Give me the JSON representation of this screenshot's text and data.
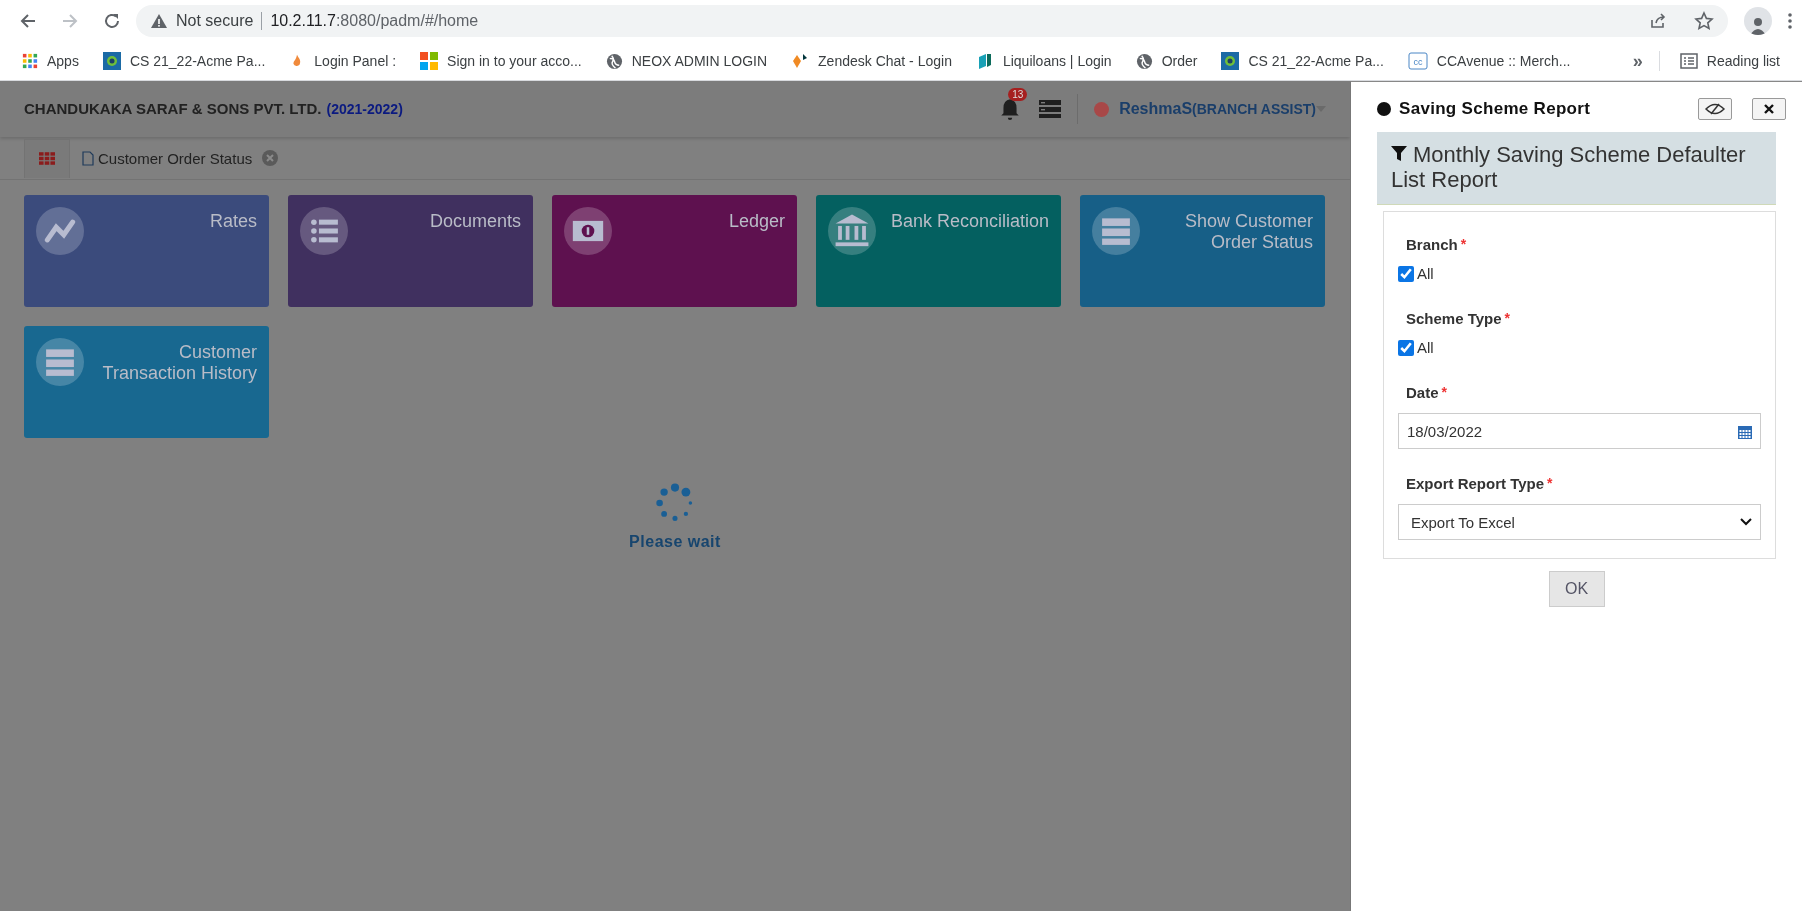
{
  "browser": {
    "security": "Not secure",
    "url_host": "10.2.11.7",
    "url_rest": ":8080/padm/#/home",
    "bookmarks": [
      {
        "kind": "apps",
        "label": "Apps"
      },
      {
        "kind": "tile",
        "label": "CS 21_22-Acme Pa..."
      },
      {
        "kind": "flame",
        "label": "Login Panel :"
      },
      {
        "kind": "windows",
        "label": "Sign in to your acco..."
      },
      {
        "kind": "globe",
        "label": "NEOX ADMIN LOGIN"
      },
      {
        "kind": "diamond",
        "label": "Zendesk Chat - Login"
      },
      {
        "kind": "book",
        "label": "Liquiloans | Login"
      },
      {
        "kind": "globe",
        "label": "Order"
      },
      {
        "kind": "tile",
        "label": "CS 21_22-Acme Pa..."
      },
      {
        "kind": "cc",
        "label": "CCAvenue :: Merch..."
      }
    ],
    "more": "»",
    "reading_list": "Reading list"
  },
  "app": {
    "company": "CHANDUKAKA SARAF & SONS PVT. LTD.",
    "year": "(2021-2022)",
    "notifications": "13",
    "user": "ReshmaS",
    "role": "(BRANCH ASSIST)",
    "tabs": [
      {
        "label": "Customer Order Status"
      }
    ],
    "tiles": [
      {
        "kind": "chart",
        "label": "Rates",
        "color": "#3b4b7c"
      },
      {
        "kind": "list",
        "label": "Documents",
        "color": "#40305f"
      },
      {
        "kind": "money",
        "label": "Ledger",
        "color": "#5e114f"
      },
      {
        "kind": "bank",
        "label": "Bank Reconciliation",
        "color": "#046060"
      },
      {
        "kind": "server",
        "label": "Show Customer\nOrder Status",
        "color": "#175f87"
      },
      {
        "kind": "server",
        "label": "Customer\nTransaction History",
        "color": "#186890"
      }
    ],
    "loading": "Please wait"
  },
  "panel": {
    "title": "Saving Scheme Report",
    "heading": "Monthly Saving Scheme Defaulter List Report",
    "fields": [
      {
        "kind": "checkbox",
        "label": "Branch",
        "required_mark": "*",
        "option": "All",
        "checked": true
      },
      {
        "kind": "checkbox",
        "label": "Scheme Type",
        "required_mark": "*",
        "option": "All",
        "checked": true
      },
      {
        "kind": "date",
        "label": "Date",
        "required_mark": "*",
        "value": "18/03/2022"
      },
      {
        "kind": "select",
        "label": "Export Report Type",
        "required_mark": "*",
        "value": "Export To Excel"
      }
    ],
    "button": "OK"
  }
}
